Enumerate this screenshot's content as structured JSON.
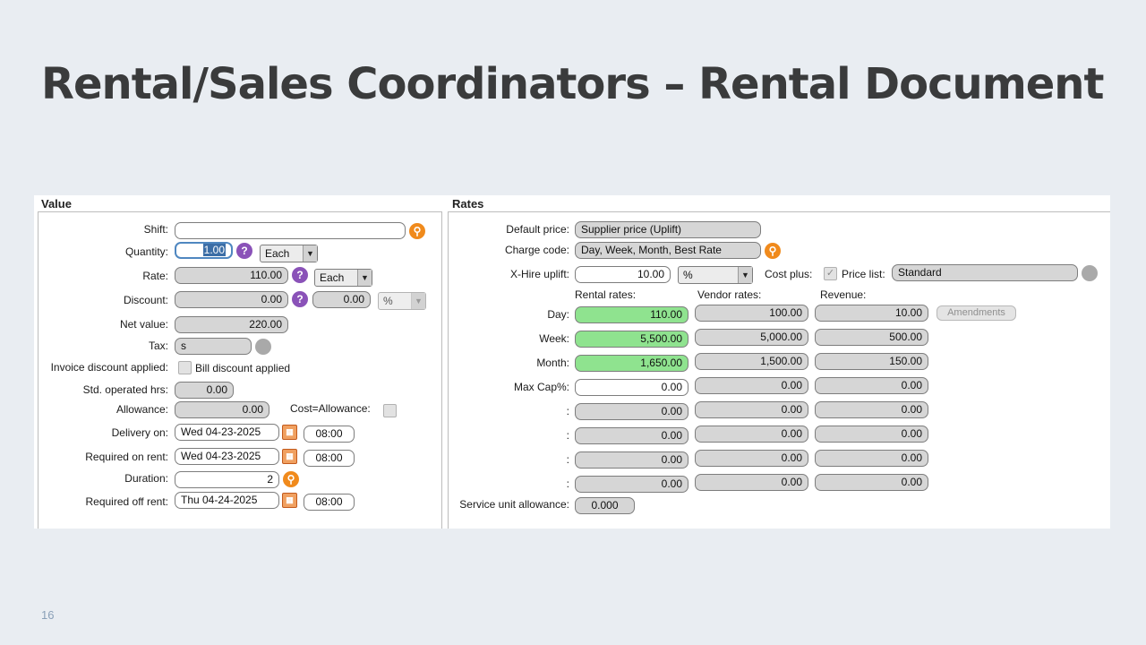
{
  "slide": {
    "title": "Rental/Sales Coordinators – Rental Document",
    "page_number": "16"
  },
  "value_panel": {
    "header": "Value",
    "shift": {
      "label": "Shift:",
      "value": ""
    },
    "quantity": {
      "label": "Quantity:",
      "value": "1.00",
      "unit": "Each"
    },
    "rate": {
      "label": "Rate:",
      "value": "110.00",
      "unit": "Each"
    },
    "discount": {
      "label": "Discount:",
      "value": "0.00",
      "value2": "0.00",
      "type": "%"
    },
    "net_value": {
      "label": "Net value:",
      "value": "220.00"
    },
    "tax": {
      "label": "Tax:",
      "value": "s"
    },
    "invoice_discount": {
      "label": "Invoice discount applied:",
      "checkbox_label": "Bill discount applied"
    },
    "std_operated_hrs": {
      "label": "Std. operated hrs:",
      "value": "0.00"
    },
    "allowance": {
      "label": "Allowance:",
      "value": "0.00",
      "cost_label": "Cost=Allowance:"
    },
    "delivery_on": {
      "label": "Delivery on:",
      "date": "Wed 04-23-2025",
      "time": "08:00"
    },
    "required_on_rent": {
      "label": "Required on rent:",
      "date": "Wed 04-23-2025",
      "time": "08:00"
    },
    "duration": {
      "label": "Duration:",
      "value": "2"
    },
    "required_off_rent": {
      "label": "Required off rent:",
      "date": "Thu 04-24-2025",
      "time": "08:00"
    }
  },
  "rates_panel": {
    "header": "Rates",
    "default_price": {
      "label": "Default price:",
      "value": "Supplier price (Uplift)"
    },
    "charge_code": {
      "label": "Charge code:",
      "value": "Day, Week, Month, Best Rate"
    },
    "x_hire_uplift": {
      "label": "X-Hire uplift:",
      "value": "10.00",
      "unit": "%"
    },
    "cost_plus": {
      "label": "Cost plus:",
      "checked": true
    },
    "price_list": {
      "label": "Price list:",
      "value": "Standard"
    },
    "columns": {
      "rental": "Rental rates:",
      "vendor": "Vendor rates:",
      "revenue": "Revenue:"
    },
    "rows": [
      {
        "label": "Day:",
        "rental": "110.00",
        "vendor": "100.00",
        "revenue": "10.00"
      },
      {
        "label": "Week:",
        "rental": "5,500.00",
        "vendor": "5,000.00",
        "revenue": "500.00"
      },
      {
        "label": "Month:",
        "rental": "1,650.00",
        "vendor": "1,500.00",
        "revenue": "150.00"
      },
      {
        "label": "Max Cap%:",
        "rental": "0.00",
        "vendor": "0.00",
        "revenue": "0.00"
      },
      {
        "label": ":",
        "rental": "0.00",
        "vendor": "0.00",
        "revenue": "0.00"
      },
      {
        "label": ":",
        "rental": "0.00",
        "vendor": "0.00",
        "revenue": "0.00"
      },
      {
        "label": ":",
        "rental": "0.00",
        "vendor": "0.00",
        "revenue": "0.00"
      },
      {
        "label": ":",
        "rental": "0.00",
        "vendor": "0.00",
        "revenue": "0.00"
      }
    ],
    "amendments_label": "Amendments",
    "service_unit_allowance": {
      "label": "Service unit allowance:",
      "value": "0.000"
    }
  },
  "icons": {
    "magnifier": "search-icon",
    "help": "help-icon",
    "calendar": "calendar-icon",
    "disabled_lookup": "lookup-icon"
  },
  "colors": {
    "rental_rate_highlight": "#8fe38f",
    "lookup_icon": "#f08a1c",
    "help_icon": "#8a52b8"
  }
}
